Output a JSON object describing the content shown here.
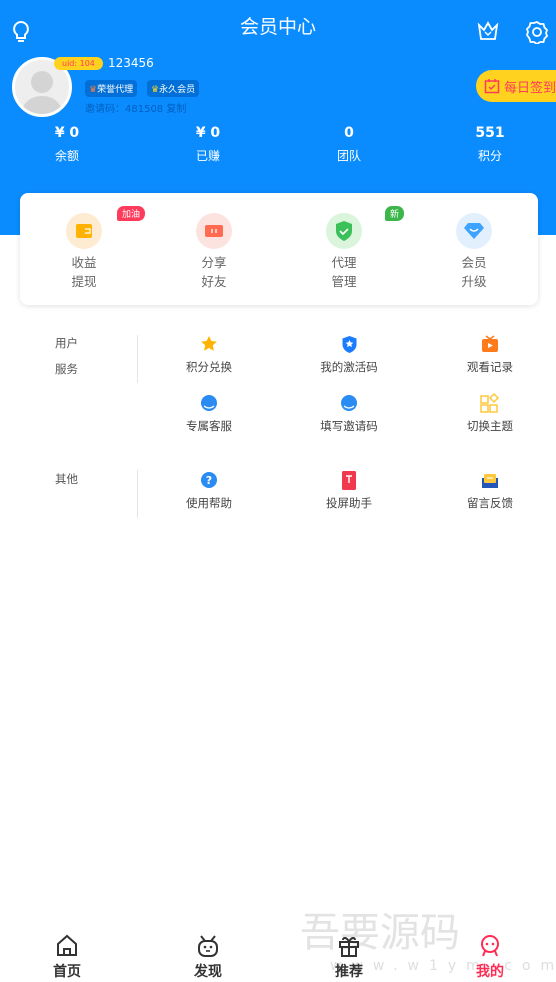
{
  "header": {
    "title": "会员中心",
    "icons": [
      "lightbulb-icon",
      "crown-icon",
      "gear-icon"
    ]
  },
  "user": {
    "uid": "uid: 104",
    "name": "123456",
    "tags": [
      "荣誉代理",
      "永久会员"
    ],
    "invite_label": "邀请码：",
    "invite_code": "481508",
    "copy": "复制",
    "sign_in": "每日签到"
  },
  "stats": [
    {
      "value": "¥ 0",
      "label": "余额"
    },
    {
      "value": "¥ 0",
      "label": "已赚"
    },
    {
      "value": "0",
      "label": "团队"
    },
    {
      "value": "551",
      "label": "积分"
    }
  ],
  "quick": [
    {
      "l1": "收益",
      "l2": "提现",
      "badge": "加油"
    },
    {
      "l1": "分享",
      "l2": "好友"
    },
    {
      "l1": "代理",
      "l2": "管理",
      "badge": "新"
    },
    {
      "l1": "会员",
      "l2": "升级"
    }
  ],
  "sections": [
    {
      "label1": "用户",
      "label2": "服务",
      "items": [
        "积分兑换",
        "我的激活码",
        "观看记录",
        "专属客服",
        "填写邀请码",
        "切换主题"
      ]
    },
    {
      "label1": "其他",
      "items": [
        "使用帮助",
        "投屏助手",
        "留言反馈"
      ]
    }
  ],
  "nav": [
    {
      "label": "首页"
    },
    {
      "label": "发现"
    },
    {
      "label": "推荐"
    },
    {
      "label": "我的",
      "active": true
    }
  ],
  "watermark": {
    "text": "吾要源码",
    "url": "www.w1ym.com"
  },
  "colors": {
    "primary": "#0a8cff",
    "accent": "#ff3b5c",
    "yellow": "#ffd21f"
  }
}
